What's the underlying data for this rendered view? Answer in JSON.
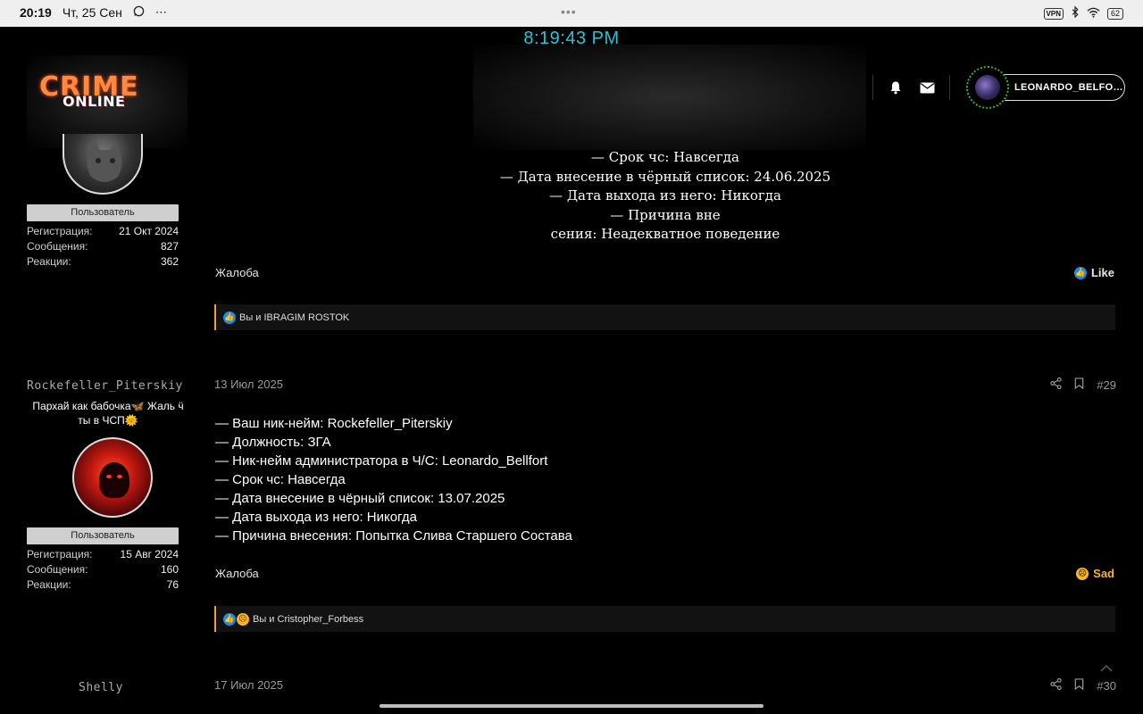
{
  "status_bar": {
    "time": "20:19",
    "date": "Чт, 25 Сен",
    "dots": "•••",
    "vpn": "VPN",
    "battery": "62",
    "icons": [
      "whatsapp-icon",
      "more-dots-icon",
      "bluetooth-icon",
      "wifi-icon"
    ]
  },
  "clock": "8:19:43 PM",
  "header": {
    "logo_line1": "CRIME",
    "logo_line2": "ONLINE",
    "username": "LEONARDO_BELFO…",
    "icons": [
      "bell-icon",
      "envelope-icon"
    ]
  },
  "user1": {
    "role": "Пользователь",
    "stats": [
      {
        "label": "Регистрация:",
        "value": "21 Окт 2024"
      },
      {
        "label": "Сообщения:",
        "value": "827"
      },
      {
        "label": "Реакции:",
        "value": "362"
      }
    ]
  },
  "post28": {
    "lines": [
      "— Срок чс: Навсегда",
      "— Дата внесение в чёрный список: 24.06.2025",
      "— Дата выхода из него: Никогда",
      "— Причина вне",
      "сения: Неадекватное поведение"
    ],
    "report": "Жалоба",
    "reaction_label": "Like",
    "reactions_text": "Вы и IBRAGIM ROSTOK"
  },
  "user2": {
    "name": "Rockefeller_Piterskiy",
    "title_line1": "Пархай как бабочка🦋 Жаль ӵ",
    "title_line2": "ты в ЧСП🌞",
    "role": "Пользователь",
    "stats": [
      {
        "label": "Регистрация:",
        "value": "15 Авг 2024"
      },
      {
        "label": "Сообщения:",
        "value": "160"
      },
      {
        "label": "Реакции:",
        "value": "76"
      }
    ]
  },
  "post29": {
    "date": "13 Июл 2025",
    "number": "#29",
    "lines": [
      "— Ваш ник-нейм: Rockefeller_Piterskiy",
      "— Должность: ЗГА",
      "— Ник-нейм администратора в Ч/С: Leonardo_Bellfort",
      "— Срок чс: Навсегда",
      "— Дата внесение в чёрный список: 13.07.2025",
      "— Дата выхода из него: Никогда",
      "— Причина внесения: Попытка Слива Старшего Состава"
    ],
    "report": "Жалоба",
    "reaction_label": "Sad",
    "reactions_text": "Вы и Cristopher_Forbess"
  },
  "user3": {
    "name": "Shelly"
  },
  "post30": {
    "date": "17 Июл 2025",
    "number": "#30"
  }
}
